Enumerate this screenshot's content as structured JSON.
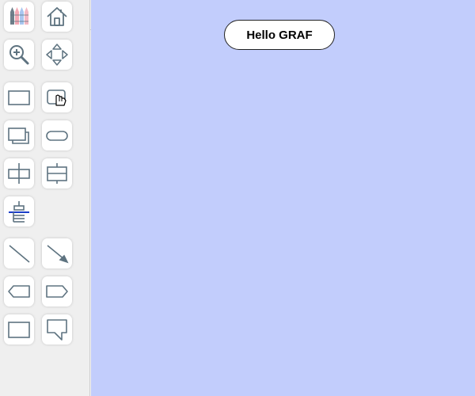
{
  "toolbar": {
    "tools": [
      {
        "name": "crayons-icon"
      },
      {
        "name": "home-icon"
      },
      {
        "name": "zoom-in-icon"
      },
      {
        "name": "pan-arrows-icon"
      },
      {
        "name": "rectangle-icon"
      },
      {
        "name": "rounded-rectangle-icon"
      },
      {
        "name": "stacked-rectangles-icon"
      },
      {
        "name": "terminator-shape-icon"
      },
      {
        "name": "node-with-vertical-ports-icon"
      },
      {
        "name": "node-with-horizontal-divider-icon"
      },
      {
        "name": "layout-tree-icon"
      },
      {
        "name": "line-icon"
      },
      {
        "name": "arrow-line-icon"
      },
      {
        "name": "left-pointed-tag-icon"
      },
      {
        "name": "right-pointed-tag-icon"
      },
      {
        "name": "plain-rectangle-icon"
      },
      {
        "name": "callout-shape-icon"
      }
    ],
    "collapse_icon": "triangle-left-icon"
  },
  "canvas": {
    "background": "#c2cdfc",
    "nodes": [
      {
        "label": "Hello GRAF"
      }
    ]
  },
  "colors": {
    "icon_stroke": "#5e7380",
    "accent_blue": "#1a3ec9"
  }
}
